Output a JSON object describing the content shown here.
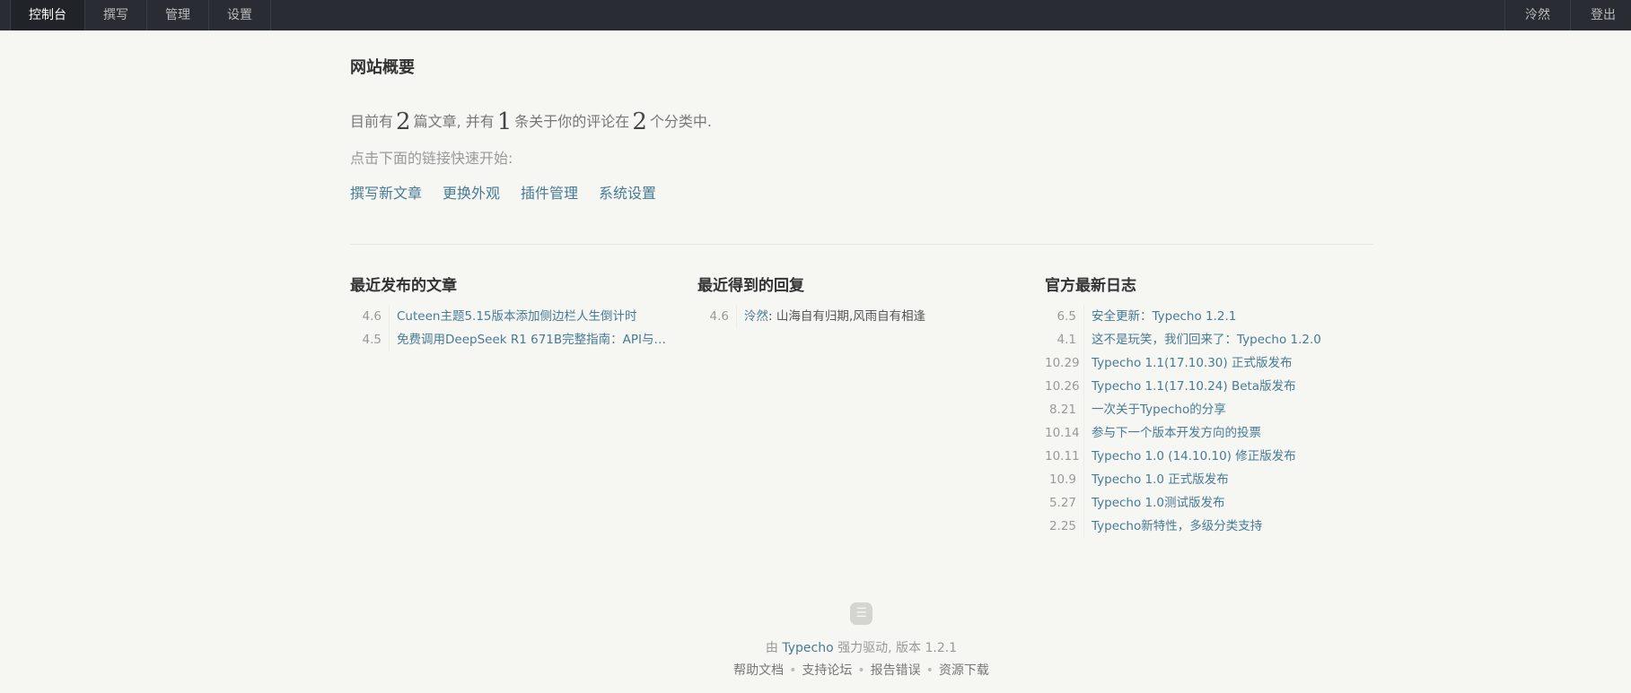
{
  "topbar": {
    "left": [
      "控制台",
      "撰写",
      "管理",
      "设置"
    ],
    "user": "泠然",
    "logout": "登出"
  },
  "page_title": "网站概要",
  "summary": {
    "prefix": "目前有",
    "posts": "2",
    "posts_unit": "篇文章, 并有",
    "comments": "1",
    "comments_unit": "条关于你的评论在",
    "categories": "2",
    "categories_unit": "个分类中."
  },
  "hint": "点击下面的链接快速开始:",
  "quick_links": [
    "撰写新文章",
    "更换外观",
    "插件管理",
    "系统设置"
  ],
  "recent_posts": {
    "title": "最近发布的文章",
    "items": [
      {
        "date": "4.6",
        "text": "Cuteen主题5.15版本添加侧边栏人生倒计时"
      },
      {
        "date": "4.5",
        "text": "免费调用DeepSeek R1 671B完整指南：API与…"
      }
    ]
  },
  "recent_comments": {
    "title": "最近得到的回复",
    "items": [
      {
        "date": "4.6",
        "author": "泠然",
        "text": "山海自有归期,风雨自有相逢"
      }
    ]
  },
  "official_logs": {
    "title": "官方最新日志",
    "items": [
      {
        "date": "6.5",
        "text": "安全更新：Typecho 1.2.1"
      },
      {
        "date": "4.1",
        "text": "这不是玩笑，我们回来了：Typecho 1.2.0"
      },
      {
        "date": "10.29",
        "text": "Typecho 1.1(17.10.30) 正式版发布"
      },
      {
        "date": "10.26",
        "text": "Typecho 1.1(17.10.24) Beta版发布"
      },
      {
        "date": "8.21",
        "text": "一次关于Typecho的分享"
      },
      {
        "date": "10.14",
        "text": "参与下一个版本开发方向的投票"
      },
      {
        "date": "10.11",
        "text": "Typecho 1.0 (14.10.10) 修正版发布"
      },
      {
        "date": "10.9",
        "text": "Typecho 1.0 正式版发布"
      },
      {
        "date": "5.27",
        "text": "Typecho 1.0测试版发布"
      },
      {
        "date": "2.25",
        "text": "Typecho新特性，多级分类支持"
      }
    ]
  },
  "footer": {
    "icon_glyph": "☰",
    "powered_prefix": "由",
    "powered_link": "Typecho",
    "powered_suffix": "强力驱动, 版本 1.2.1",
    "links": [
      "帮助文档",
      "支持论坛",
      "报告错误",
      "资源下载"
    ]
  }
}
